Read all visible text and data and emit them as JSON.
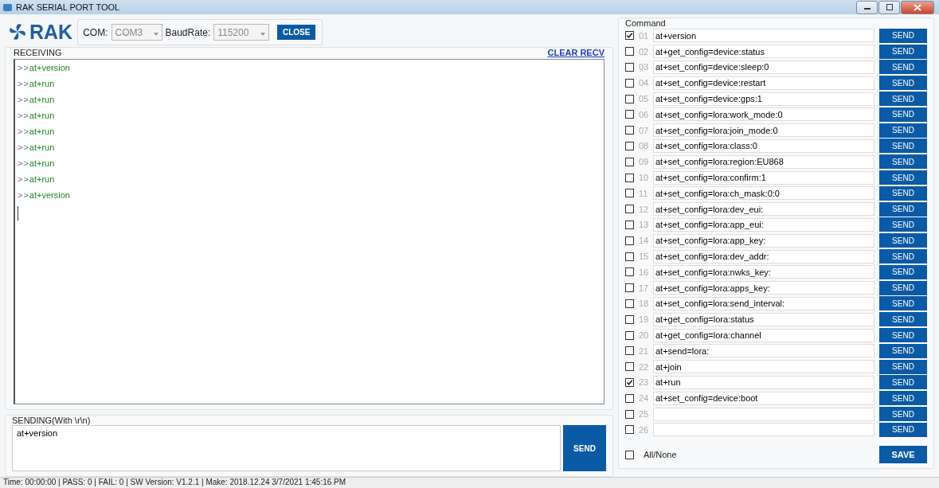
{
  "window": {
    "title": "RAK SERIAL PORT TOOL"
  },
  "logo": {
    "text": "RAK"
  },
  "port": {
    "com_label": "COM:",
    "com_value": "COM3",
    "baud_label": "BaudRate:",
    "baud_value": "115200",
    "button": "CLOSE"
  },
  "receiving": {
    "title": "RECEIVING",
    "clear": "CLEAR RECV",
    "lines": [
      {
        "prefix": ">>",
        "text": "at+version"
      },
      {
        "prefix": ">>",
        "text": "at+run"
      },
      {
        "prefix": ">>",
        "text": "at+run"
      },
      {
        "prefix": ">>",
        "text": "at+run"
      },
      {
        "prefix": ">>",
        "text": "at+run"
      },
      {
        "prefix": ">>",
        "text": "at+run"
      },
      {
        "prefix": ">>",
        "text": "at+run"
      },
      {
        "prefix": ">>",
        "text": "at+run"
      },
      {
        "prefix": ">>",
        "text": "at+version"
      }
    ]
  },
  "sending": {
    "title": "SENDING(With \\r\\n)",
    "value": "at+version",
    "button": "SEND"
  },
  "command": {
    "title": "Command",
    "items": [
      {
        "number": "01",
        "checked": true,
        "value": "at+version",
        "send": "SEND"
      },
      {
        "number": "02",
        "checked": false,
        "value": "at+get_config=device:status",
        "send": "SEND"
      },
      {
        "number": "03",
        "checked": false,
        "value": "at+set_config=device:sleep:0",
        "send": "SEND"
      },
      {
        "number": "04",
        "checked": false,
        "value": "at+set_config=device:restart",
        "send": "SEND"
      },
      {
        "number": "05",
        "checked": false,
        "value": "at+set_config=device:gps:1",
        "send": "SEND"
      },
      {
        "number": "06",
        "checked": false,
        "value": "at+set_config=lora:work_mode:0",
        "send": "SEND"
      },
      {
        "number": "07",
        "checked": false,
        "value": "at+set_config=lora:join_mode:0",
        "send": "SEND"
      },
      {
        "number": "08",
        "checked": false,
        "value": "at+set_config=lora:class:0",
        "send": "SEND"
      },
      {
        "number": "09",
        "checked": false,
        "value": "at+set_config=lora:region:EU868",
        "send": "SEND"
      },
      {
        "number": "10",
        "checked": false,
        "value": "at+set_config=lora:confirm:1",
        "send": "SEND"
      },
      {
        "number": "11",
        "checked": false,
        "value": "at+set_config=lora:ch_mask:0:0",
        "send": "SEND"
      },
      {
        "number": "12",
        "checked": false,
        "value": "at+set_config=lora:dev_eui:",
        "send": "SEND"
      },
      {
        "number": "13",
        "checked": false,
        "value": "at+set_config=lora:app_eui:",
        "send": "SEND"
      },
      {
        "number": "14",
        "checked": false,
        "value": "at+set_config=lora:app_key:",
        "send": "SEND"
      },
      {
        "number": "15",
        "checked": false,
        "value": "at+set_config=lora:dev_addr:",
        "send": "SEND"
      },
      {
        "number": "16",
        "checked": false,
        "value": "at+set_config=lora:nwks_key:",
        "send": "SEND"
      },
      {
        "number": "17",
        "checked": false,
        "value": "at+set_config=lora:apps_key:",
        "send": "SEND"
      },
      {
        "number": "18",
        "checked": false,
        "value": "at+set_config=lora:send_interval:",
        "send": "SEND"
      },
      {
        "number": "19",
        "checked": false,
        "value": "at+get_config=lora:status",
        "send": "SEND"
      },
      {
        "number": "20",
        "checked": false,
        "value": "at+get_config=lora:channel",
        "send": "SEND"
      },
      {
        "number": "21",
        "checked": false,
        "value": "at+send=lora:",
        "send": "SEND"
      },
      {
        "number": "22",
        "checked": false,
        "value": "at+join",
        "send": "SEND"
      },
      {
        "number": "23",
        "checked": true,
        "value": "at+run",
        "send": "SEND"
      },
      {
        "number": "24",
        "checked": false,
        "value": "at+set_config=device:boot",
        "send": "SEND"
      },
      {
        "number": "25",
        "checked": false,
        "send": "SEND"
      },
      {
        "number": "26",
        "checked": false,
        "send": "SEND"
      }
    ],
    "all_none": {
      "label": "All/None",
      "checked": false
    },
    "save": "SAVE"
  },
  "status_bar": "Time: 00:00:00 | PASS: 0 | FAIL: 0 | SW Version: V1.2.1 | Make: 2018.12.24 3/7/2021 1:45:16 PM"
}
